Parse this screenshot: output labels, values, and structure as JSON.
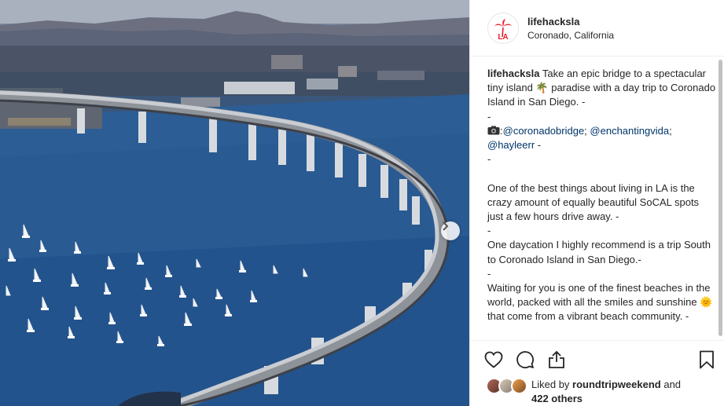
{
  "colors": {
    "brand_red": "#e8202b",
    "link_blue": "#003569",
    "text": "#262626",
    "border": "#efefef"
  },
  "media": {
    "next_icon": "chevron-right-icon"
  },
  "header": {
    "username": "lifehacksla",
    "location": "Coronado, California",
    "avatar_text": "LA",
    "avatar_icon": "palm-tree-icon"
  },
  "caption": {
    "username": "lifehacksla",
    "line1": " Take an epic bridge to a spectacular tiny island ",
    "emoji_palm": "🌴",
    "line1b": " paradise with a day trip to Coronado Island in San Diego. -",
    "dash1": "-",
    "camera_icon": "camera-icon",
    "camera_prefix": ":",
    "mention1": "@coronadobridge",
    "sep1": "; ",
    "mention2": "@enchantingvida",
    "sep2": ";",
    "mention3": "@hayleerr",
    "after_mentions": " -",
    "dash2": "-",
    "para2": "One of the best things about living in LA is the crazy amount of equally beautiful SoCAL spots just a few hours drive away. -",
    "dash3": "-",
    "para3": "One daycation I highly recommend is a trip South to Coronado Island in San Diego.-",
    "dash4": "-",
    "para4a": "Waiting for you is one of the finest beaches in the world, packed with all the smiles and sunshine ",
    "emoji_sun": "🌞",
    "para4b": " that come from a vibrant beach community. -"
  },
  "actions": {
    "like_icon": "heart-icon",
    "comment_icon": "comment-icon",
    "share_icon": "share-icon",
    "save_icon": "bookmark-icon"
  },
  "likes": {
    "prefix": "Liked by ",
    "user": "roundtripweekend",
    "middle": " and",
    "count": "422 others"
  }
}
